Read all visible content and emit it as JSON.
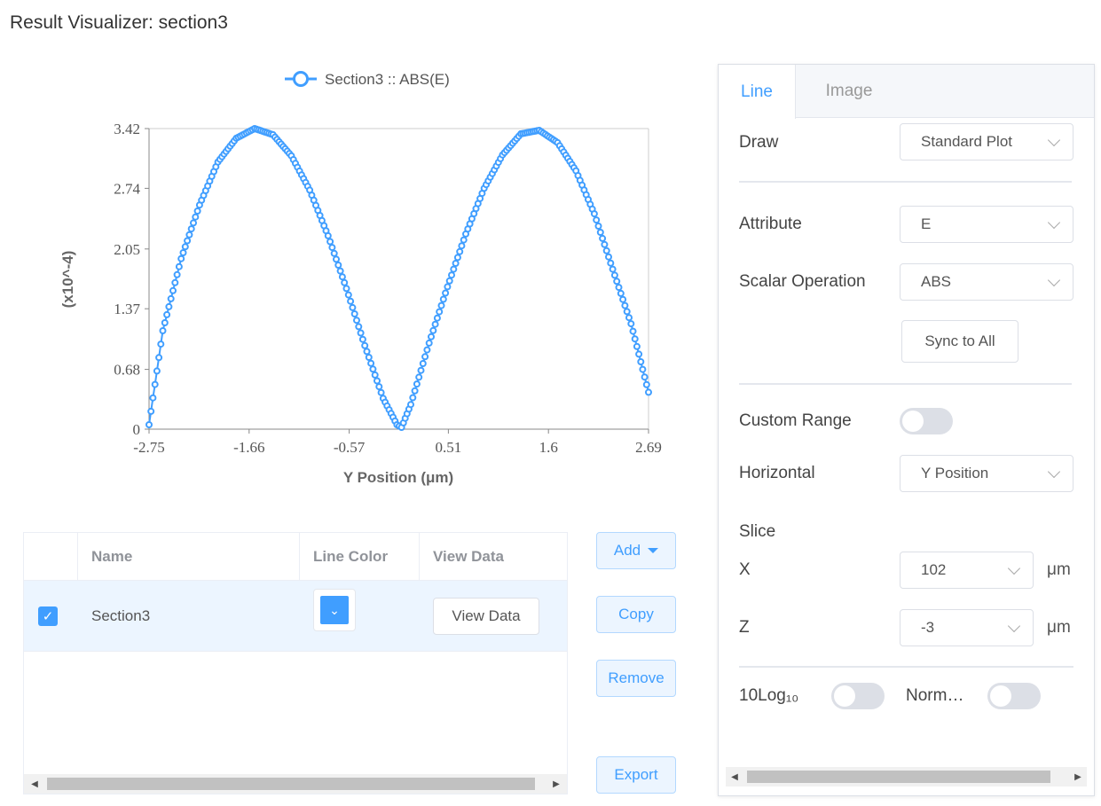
{
  "title": "Result Visualizer: section3",
  "chart_data": {
    "type": "line",
    "legend": "Section3 :: ABS(E)",
    "xlabel": "Y Position (μm)",
    "ylabel": "(x10^-4)",
    "xlim": [
      -2.75,
      2.69
    ],
    "ylim": [
      0,
      3.42
    ],
    "x_ticks": [
      "-2.75",
      "-1.66",
      "-0.57",
      "0.51",
      "1.6",
      "2.69"
    ],
    "y_ticks": [
      "0",
      "0.68",
      "1.37",
      "2.05",
      "2.74",
      "3.42"
    ],
    "color": "#409eff",
    "series": [
      {
        "x": [
          -2.75,
          -2.6,
          -2.4,
          -2.2,
          -2.0,
          -1.8,
          -1.6,
          -1.4,
          -1.2,
          -1.0,
          -0.8,
          -0.6,
          -0.4,
          -0.2,
          -0.05,
          0.0,
          0.1,
          0.3,
          0.5,
          0.7,
          0.9,
          1.1,
          1.3,
          1.5,
          1.7,
          1.9,
          2.1,
          2.3,
          2.5,
          2.69
        ],
        "y": [
          0.05,
          1.12,
          1.94,
          2.55,
          3.04,
          3.31,
          3.42,
          3.35,
          3.11,
          2.72,
          2.2,
          1.6,
          0.95,
          0.35,
          0.05,
          0.02,
          0.28,
          0.98,
          1.62,
          2.22,
          2.74,
          3.12,
          3.36,
          3.4,
          3.26,
          2.94,
          2.45,
          1.82,
          1.2,
          0.42
        ]
      }
    ]
  },
  "table": {
    "headers": [
      "Name",
      "Line Color",
      "View Data"
    ],
    "rows": [
      {
        "checked": true,
        "name": "Section3",
        "color": "#409eff",
        "view": "View Data"
      }
    ]
  },
  "buttons": {
    "add": "Add",
    "copy": "Copy",
    "remove": "Remove",
    "export": "Export"
  },
  "panel": {
    "tabs": [
      "Line",
      "Image"
    ],
    "draw_label": "Draw",
    "draw_value": "Standard Plot",
    "attribute_label": "Attribute",
    "attribute_value": "E",
    "scalar_label": "Scalar Operation",
    "scalar_value": "ABS",
    "sync": "Sync to All",
    "custom_range_label": "Custom Range",
    "custom_range_on": false,
    "horizontal_label": "Horizontal",
    "horizontal_value": "Y Position",
    "slice_label": "Slice",
    "x_label": "X",
    "x_value": "102",
    "x_unit": "μm",
    "z_label": "Z",
    "z_value": "-3",
    "z_unit": "μm",
    "log_label": "10Log₁₀",
    "log_on": false,
    "norm_label": "Norm…",
    "norm_on": false
  }
}
